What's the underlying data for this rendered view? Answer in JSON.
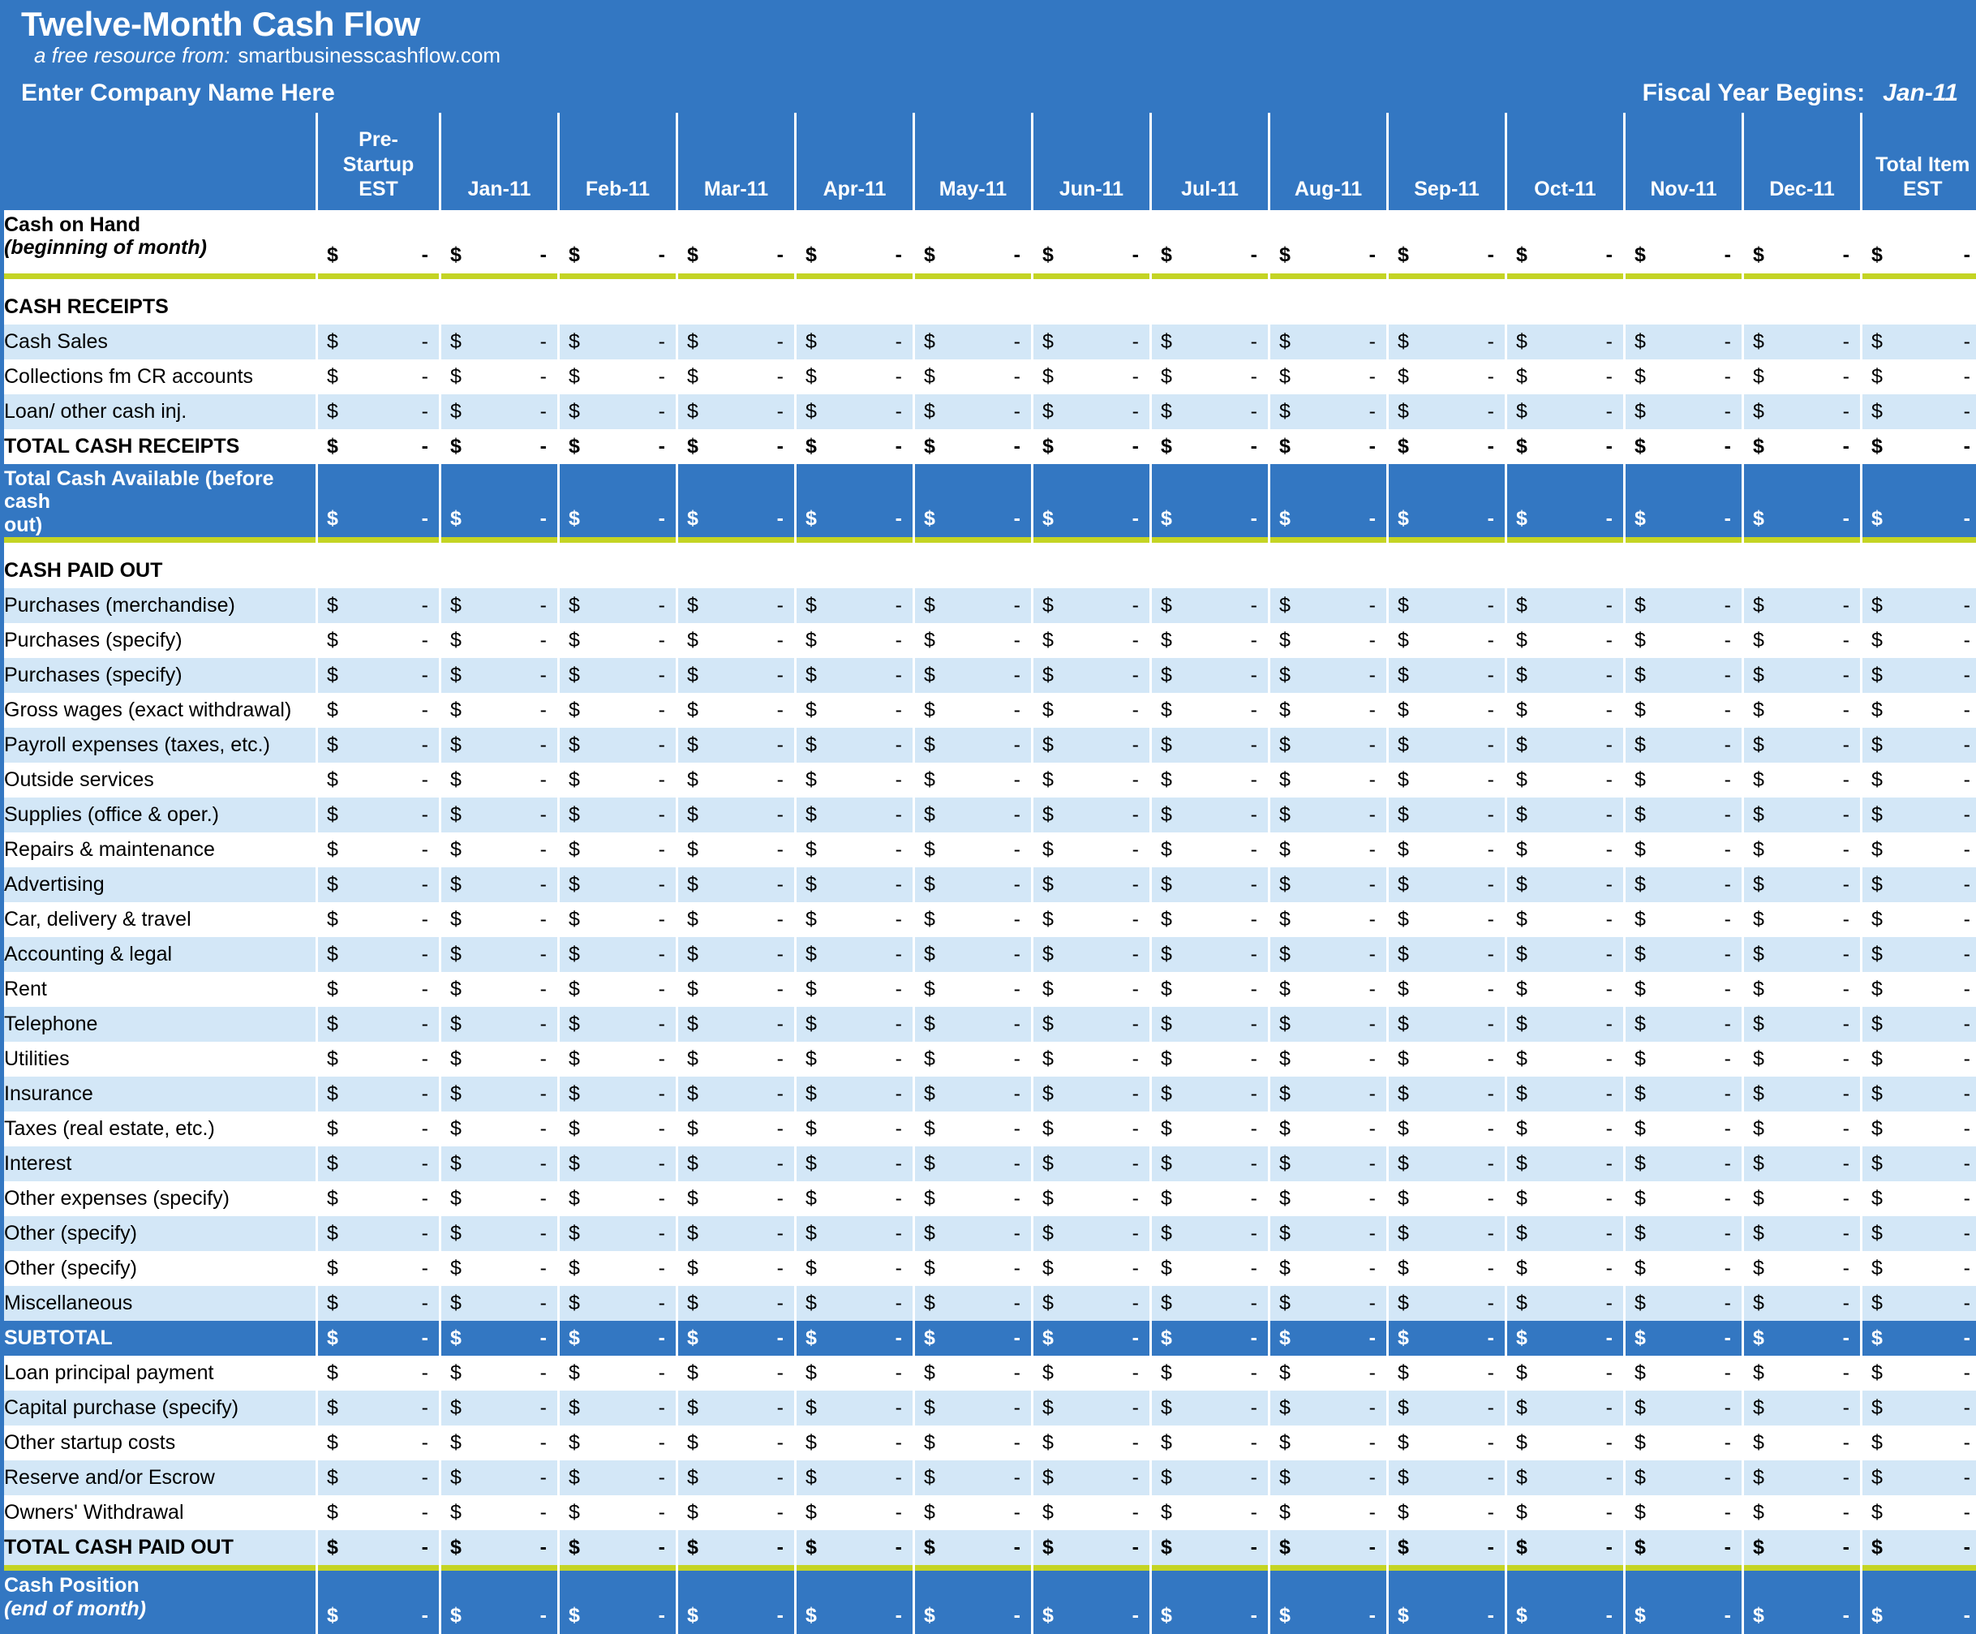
{
  "banner": {
    "title": "Twelve-Month Cash Flow",
    "subtitle_prefix": "a free resource from:",
    "subtitle_site": "smartbusinesscashflow.com",
    "company_name": "Enter Company Name Here",
    "fiscal_label": "Fiscal Year Begins:",
    "fiscal_value": "Jan-11"
  },
  "colors": {
    "header_blue": "#3377C2",
    "light_blue": "#D3E7F7",
    "lime": "#C4D424",
    "white": "#FFFFFF"
  },
  "columns": {
    "label_header": "",
    "pre_startup_l1": "Pre-",
    "pre_startup_l2": "Startup",
    "pre_startup_l3": "EST",
    "months": [
      "Jan-11",
      "Feb-11",
      "Mar-11",
      "Apr-11",
      "May-11",
      "Jun-11",
      "Jul-11",
      "Aug-11",
      "Sep-11",
      "Oct-11",
      "Nov-11",
      "Dec-11"
    ],
    "total_l1": "Total Item",
    "total_l2": "EST"
  },
  "symbols": {
    "dollar": "$",
    "dash": "-"
  },
  "rows": [
    {
      "id": "cash-on-hand",
      "label_l1": "Cash on Hand",
      "label_l2": "(beginning of month)",
      "style": "white",
      "bold": true,
      "tall": true,
      "values": true
    },
    {
      "id": "lime-1",
      "style": "lime"
    },
    {
      "id": "cash-receipts-header",
      "label_l1": "CASH RECEIPTS",
      "style": "white",
      "bold": true,
      "values": false
    },
    {
      "id": "cash-sales",
      "label_l1": "Cash Sales",
      "style": "blue",
      "values": true
    },
    {
      "id": "collections-fm-cr-accounts",
      "label_l1": "Collections fm CR accounts",
      "style": "white",
      "values": true
    },
    {
      "id": "loan-other-cash-inj",
      "label_l1": "Loan/ other cash inj.",
      "style": "blue",
      "values": true
    },
    {
      "id": "total-cash-receipts",
      "label_l1": "TOTAL CASH RECEIPTS",
      "style": "white",
      "bold": true,
      "values": true
    },
    {
      "id": "total-cash-available",
      "label_l1": "Total Cash Available (before cash",
      "label_l2": "out)",
      "style": "dark",
      "bold": true,
      "tall": true,
      "values": true,
      "plain2": true
    },
    {
      "id": "lime-2",
      "style": "lime"
    },
    {
      "id": "cash-paid-out-header",
      "label_l1": "CASH PAID OUT",
      "style": "white",
      "bold": true,
      "values": false
    },
    {
      "id": "purchases-merchandise",
      "label_l1": "Purchases (merchandise)",
      "style": "blue",
      "values": true
    },
    {
      "id": "purchases-specify-1",
      "label_l1": "Purchases (specify)",
      "style": "white",
      "values": true
    },
    {
      "id": "purchases-specify-2",
      "label_l1": "Purchases (specify)",
      "style": "blue",
      "values": true
    },
    {
      "id": "gross-wages",
      "label_l1": "Gross wages (exact withdrawal)",
      "style": "white",
      "values": true
    },
    {
      "id": "payroll-expenses",
      "label_l1": "Payroll expenses (taxes, etc.)",
      "style": "blue",
      "values": true
    },
    {
      "id": "outside-services",
      "label_l1": "Outside services",
      "style": "white",
      "values": true
    },
    {
      "id": "supplies",
      "label_l1": "Supplies (office & oper.)",
      "style": "blue",
      "values": true
    },
    {
      "id": "repairs-maintenance",
      "label_l1": "Repairs & maintenance",
      "style": "white",
      "values": true
    },
    {
      "id": "advertising",
      "label_l1": "Advertising",
      "style": "blue",
      "values": true
    },
    {
      "id": "car-delivery-travel",
      "label_l1": "Car, delivery & travel",
      "style": "white",
      "values": true
    },
    {
      "id": "accounting-legal",
      "label_l1": "Accounting & legal",
      "style": "blue",
      "values": true
    },
    {
      "id": "rent",
      "label_l1": "Rent",
      "style": "white",
      "values": true
    },
    {
      "id": "telephone",
      "label_l1": "Telephone",
      "style": "blue",
      "values": true
    },
    {
      "id": "utilities",
      "label_l1": "Utilities",
      "style": "white",
      "values": true
    },
    {
      "id": "insurance",
      "label_l1": "Insurance",
      "style": "blue",
      "values": true
    },
    {
      "id": "taxes-real-estate",
      "label_l1": "Taxes (real estate, etc.)",
      "style": "white",
      "values": true
    },
    {
      "id": "interest",
      "label_l1": "Interest",
      "style": "blue",
      "values": true
    },
    {
      "id": "other-expenses-specify",
      "label_l1": "Other expenses (specify)",
      "style": "white",
      "values": true
    },
    {
      "id": "other-specify-1",
      "label_l1": "Other (specify)",
      "style": "blue",
      "values": true
    },
    {
      "id": "other-specify-2",
      "label_l1": "Other (specify)",
      "style": "white",
      "values": true
    },
    {
      "id": "miscellaneous",
      "label_l1": "Miscellaneous",
      "style": "blue",
      "values": true
    },
    {
      "id": "subtotal",
      "label_l1": "SUBTOTAL",
      "style": "dark",
      "bold": true,
      "values": true
    },
    {
      "id": "loan-principal-payment",
      "label_l1": "Loan principal payment",
      "style": "white",
      "values": true
    },
    {
      "id": "capital-purchase-specify",
      "label_l1": "Capital purchase (specify)",
      "style": "blue",
      "values": true
    },
    {
      "id": "other-startup-costs",
      "label_l1": "Other startup costs",
      "style": "white",
      "values": true
    },
    {
      "id": "reserve-escrow",
      "label_l1": "Reserve and/or Escrow",
      "style": "blue",
      "values": true
    },
    {
      "id": "owners-withdrawal",
      "label_l1": "Owners' Withdrawal",
      "style": "white",
      "values": true
    },
    {
      "id": "total-cash-paid-out",
      "label_l1": "TOTAL CASH PAID OUT",
      "style": "blue",
      "bold": true,
      "values": true
    },
    {
      "id": "lime-3",
      "style": "lime"
    },
    {
      "id": "cash-position",
      "label_l1": "Cash Position",
      "label_l2": "(end of month)",
      "style": "dark",
      "bold": true,
      "tall": true,
      "values": true
    }
  ]
}
